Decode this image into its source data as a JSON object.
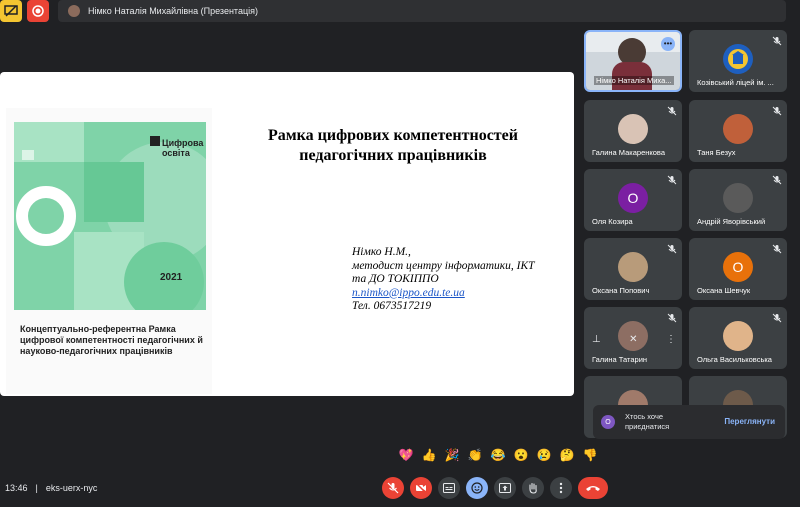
{
  "presentation_banner": {
    "text": "Німко Наталія Михайлівна (Презентація)"
  },
  "slide": {
    "title_line1": "Рамка цифрових компетентностей",
    "title_line2": "педагогічних працівників",
    "author": "Німко Н.М.,",
    "role_line1": "методист центру інформатики, ІКТ",
    "role_line2": "та ДО ТОКІППО",
    "email": "n.nimko@ippo.edu.te.ua",
    "phone": "Тел. 0673517219",
    "cover": {
      "logo_text": "Цифрова освіта",
      "year": "2021",
      "caption": "Концептуально-референтна Рамка цифрової компетентності педагогічних й науково-педагогічних працівників"
    }
  },
  "participants": [
    {
      "name": "Німко Наталія Миха...",
      "type": "video"
    },
    {
      "name": "Козівський ліцей ім. ...",
      "type": "image"
    },
    {
      "name": "Галина Макаренкова",
      "type": "photo"
    },
    {
      "name": "Таня Безух",
      "type": "photo"
    },
    {
      "name": "Оля Козира",
      "type": "letter",
      "letter": "О",
      "color": "#7b1fa2"
    },
    {
      "name": "Андрій Яворівський",
      "type": "photo"
    },
    {
      "name": "Оксана Попович",
      "type": "photo"
    },
    {
      "name": "Оксана Шевчук",
      "type": "letter",
      "letter": "О",
      "color": "#e8710a"
    },
    {
      "name": "Галина Татарин",
      "type": "photo"
    },
    {
      "name": "Ольга Васильковська",
      "type": "photo"
    }
  ],
  "notification": {
    "icon_letter": "О",
    "text": "Хтось хоче приєднатися",
    "action": "Переглянути"
  },
  "reactions": [
    "💖",
    "👍",
    "🎉",
    "👏",
    "😂",
    "😮",
    "😢",
    "🤔",
    "👎"
  ],
  "meeting": {
    "time": "13:46",
    "separator": "|",
    "code": "eks-uerx-nyc"
  },
  "colors": {
    "accent": "#8ab4f8",
    "danger": "#ea4335",
    "present": "#f4c531"
  }
}
